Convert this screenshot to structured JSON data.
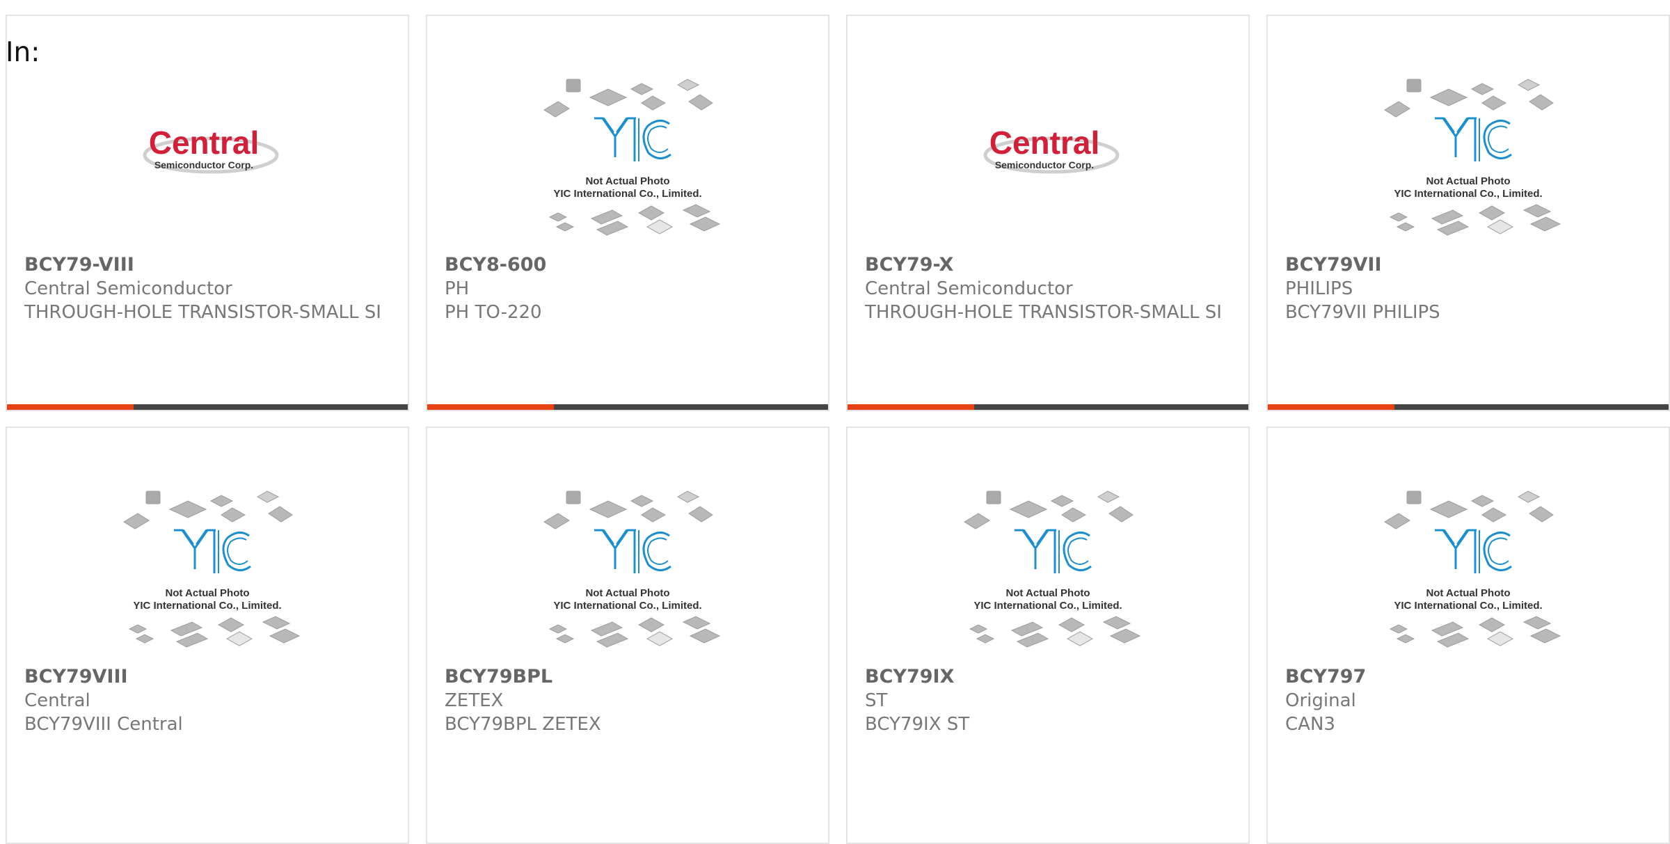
{
  "header": {
    "label": "In:"
  },
  "colors": {
    "accent": "#e84112",
    "bar": "#444444",
    "yic_blue": "#1c8fd1",
    "central_red": "#d21f3a"
  },
  "placeholder": {
    "line1": "Not Actual Photo",
    "line2": "YIC International Co., Limited.",
    "logo_text": "YIC"
  },
  "central_logo": {
    "name": "Central",
    "tagline": "Semiconductor Corp."
  },
  "products": [
    {
      "part": "BCY79-VIII",
      "manufacturer": "Central Semiconductor",
      "description": "THROUGH-HOLE TRANSISTOR-SMALL SI",
      "image": "central-logo"
    },
    {
      "part": "BCY8-600",
      "manufacturer": "PH",
      "description": "PH TO-220",
      "image": "yic-placeholder"
    },
    {
      "part": "BCY79-X",
      "manufacturer": "Central Semiconductor",
      "description": "THROUGH-HOLE TRANSISTOR-SMALL SI",
      "image": "central-logo"
    },
    {
      "part": "BCY79VII",
      "manufacturer": "PHILIPS",
      "description": "BCY79VII PHILIPS",
      "image": "yic-placeholder"
    },
    {
      "part": "BCY79VIII",
      "manufacturer": "Central",
      "description": "BCY79VIII Central",
      "image": "yic-placeholder"
    },
    {
      "part": "BCY79BPL",
      "manufacturer": "ZETEX",
      "description": "BCY79BPL ZETEX",
      "image": "yic-placeholder"
    },
    {
      "part": "BCY79IX",
      "manufacturer": "ST",
      "description": "BCY79IX ST",
      "image": "yic-placeholder"
    },
    {
      "part": "BCY797",
      "manufacturer": "Original",
      "description": "CAN3",
      "image": "yic-placeholder"
    }
  ]
}
